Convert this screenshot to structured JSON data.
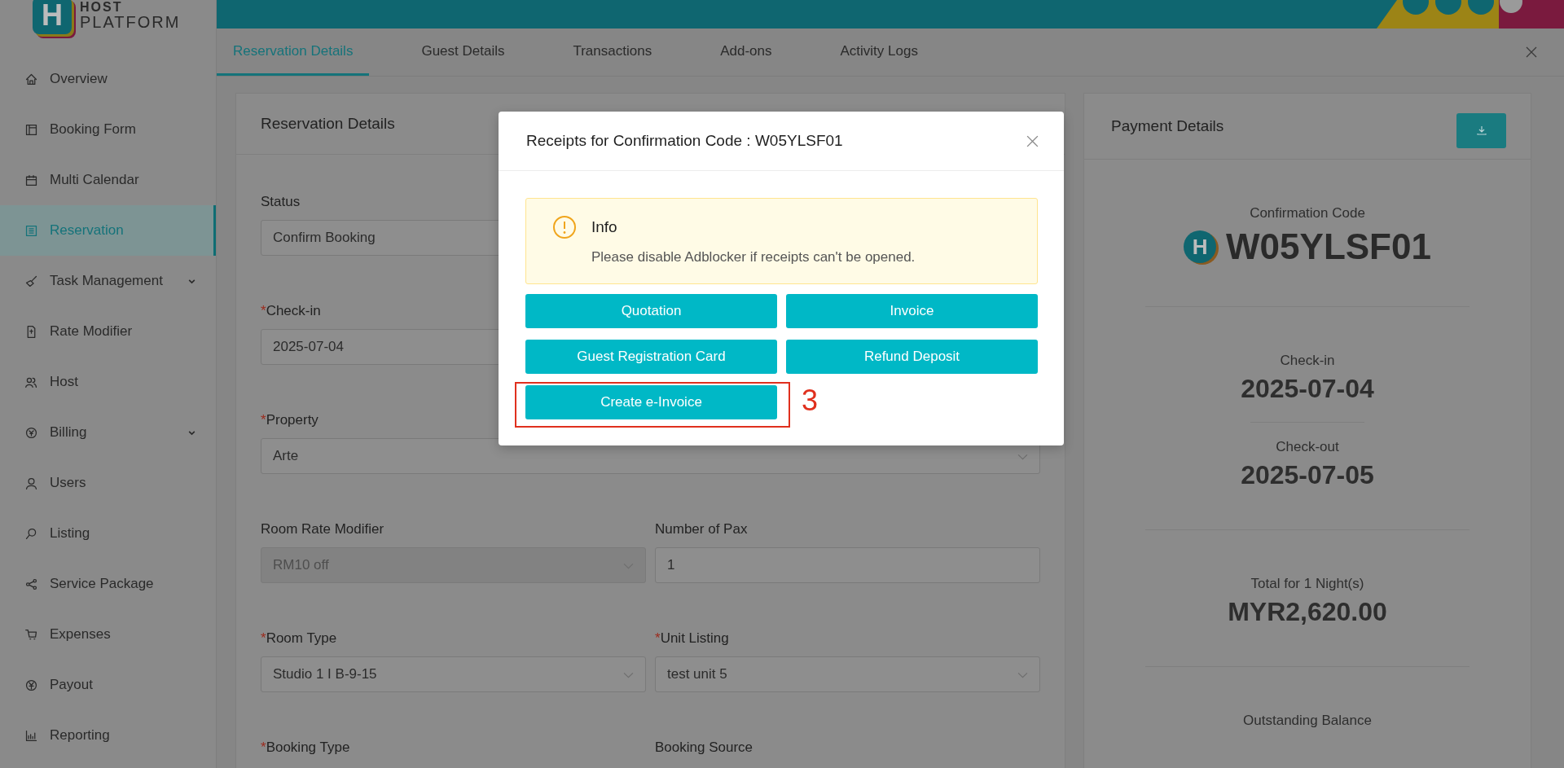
{
  "brand": {
    "mark": "H",
    "line1": "HOST",
    "line2": "PLATFORM"
  },
  "sidebar": {
    "items": [
      {
        "label": "Overview",
        "selected": false,
        "expandable": false
      },
      {
        "label": "Booking Form",
        "selected": false,
        "expandable": false
      },
      {
        "label": "Multi Calendar",
        "selected": false,
        "expandable": false
      },
      {
        "label": "Reservation",
        "selected": true,
        "expandable": false
      },
      {
        "label": "Task Management",
        "selected": false,
        "expandable": true
      },
      {
        "label": "Rate Modifier",
        "selected": false,
        "expandable": false
      },
      {
        "label": "Host",
        "selected": false,
        "expandable": false
      },
      {
        "label": "Billing",
        "selected": false,
        "expandable": true
      },
      {
        "label": "Users",
        "selected": false,
        "expandable": false
      },
      {
        "label": "Listing",
        "selected": false,
        "expandable": false
      },
      {
        "label": "Service Package",
        "selected": false,
        "expandable": false
      },
      {
        "label": "Expenses",
        "selected": false,
        "expandable": false
      },
      {
        "label": "Payout",
        "selected": false,
        "expandable": false
      },
      {
        "label": "Reporting",
        "selected": false,
        "expandable": false
      }
    ]
  },
  "tabs": [
    {
      "label": "Reservation Details",
      "selected": true
    },
    {
      "label": "Guest Details",
      "selected": false
    },
    {
      "label": "Transactions",
      "selected": false
    },
    {
      "label": "Add-ons",
      "selected": false
    },
    {
      "label": "Activity Logs",
      "selected": false
    }
  ],
  "form": {
    "title": "Reservation Details",
    "rows": [
      [
        {
          "label": "Status",
          "value": "Confirm Booking",
          "disabled": false
        }
      ],
      [
        {
          "mark": "*",
          "label": "Check-in",
          "kind": "text",
          "value": "2025-07-04",
          "disabled": false
        }
      ],
      [
        {
          "mark": "*",
          "label": "Property",
          "kind": "select",
          "value": "Arte",
          "disabled": false
        }
      ],
      [
        {
          "label": "Room Rate Modifier",
          "kind": "select",
          "value": "RM10 off",
          "disabled": true
        },
        {
          "label": "Number of Pax",
          "kind": "text",
          "value": "1",
          "disabled": false
        }
      ],
      [
        {
          "mark": "*",
          "label": "Room Type",
          "kind": "select",
          "value": "Studio 1 I B-9-15",
          "disabled": false
        },
        {
          "mark": "*",
          "label": "Unit Listing",
          "kind": "select",
          "value": "test unit 5",
          "disabled": false
        }
      ],
      [
        {
          "mark": "*",
          "label": "Booking Type"
        },
        {
          "label": "Booking Source"
        }
      ]
    ]
  },
  "payment": {
    "title": "Payment Details",
    "groups": [
      [
        {
          "label": "Confirmation Code",
          "value": "W05YLSF01",
          "badge": "H"
        }
      ],
      [
        {
          "label": "Check-in",
          "value": "2025-07-04"
        },
        {
          "label": "Check-out",
          "value": "2025-07-05"
        }
      ],
      [
        {
          "label": "Total for 1 Night(s)",
          "value": "MYR2,620.00"
        }
      ],
      [
        {
          "label": "Outstanding Balance"
        }
      ]
    ]
  },
  "modal": {
    "title": "Receipts for Confirmation Code : W05YLSF01",
    "info": {
      "title": "Info",
      "text": "Please disable Adblocker if receipts can't be opened."
    },
    "buttons": [
      {
        "label": "Quotation",
        "highlighted": false
      },
      {
        "label": "Invoice",
        "highlighted": false
      },
      {
        "label": "Guest Registration Card",
        "highlighted": false
      },
      {
        "label": "Refund Deposit",
        "highlighted": false
      },
      {
        "label": "Create e-Invoice",
        "highlighted": true
      }
    ],
    "annotation": "3"
  }
}
